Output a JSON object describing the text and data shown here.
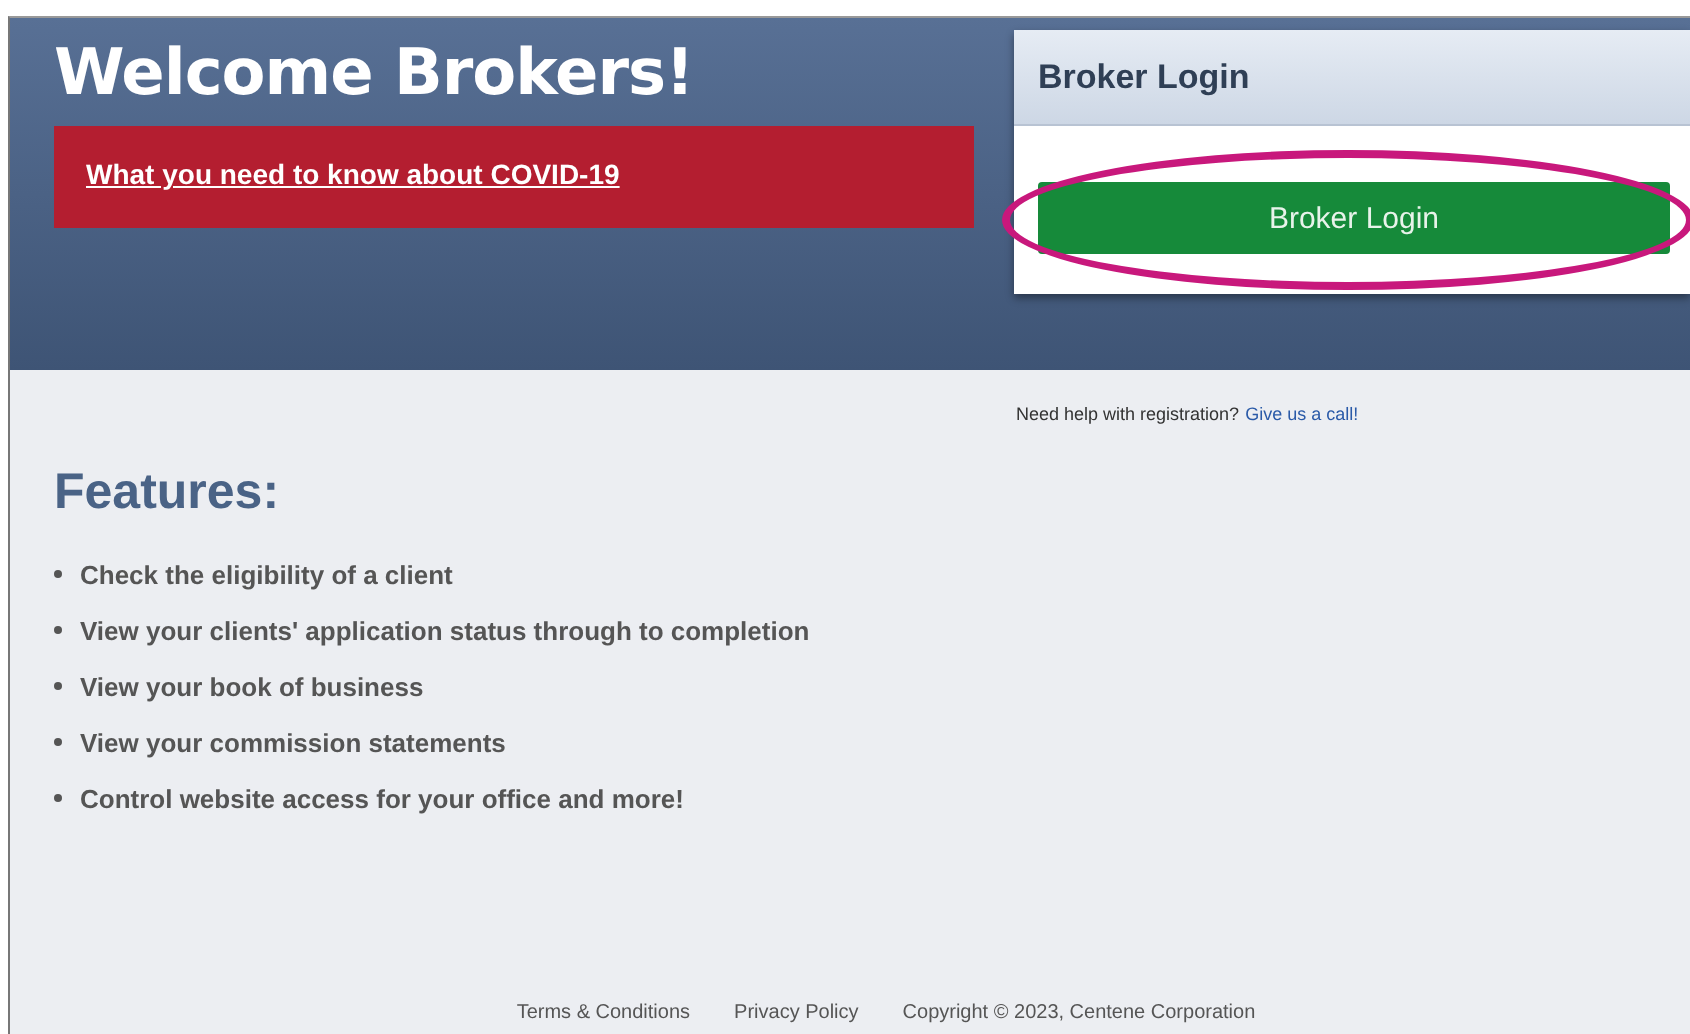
{
  "header": {
    "title": "Welcome Brokers!",
    "alert_link": "What you need to know about COVID-19"
  },
  "login_card": {
    "title": "Broker Login",
    "button": "Broker Login"
  },
  "help": {
    "text": "Need help with registration?",
    "link": "Give us a call!"
  },
  "features": {
    "title": "Features:",
    "items": [
      "Check the eligibility of a client",
      "View your clients' application status through to completion",
      "View your book of business",
      "View your commission statements",
      "Control website access for your office and more!"
    ]
  },
  "footer": {
    "links": [
      "Terms & Conditions",
      "Privacy Policy"
    ],
    "copyright": "Copyright © 2023, Centene Corporation"
  }
}
